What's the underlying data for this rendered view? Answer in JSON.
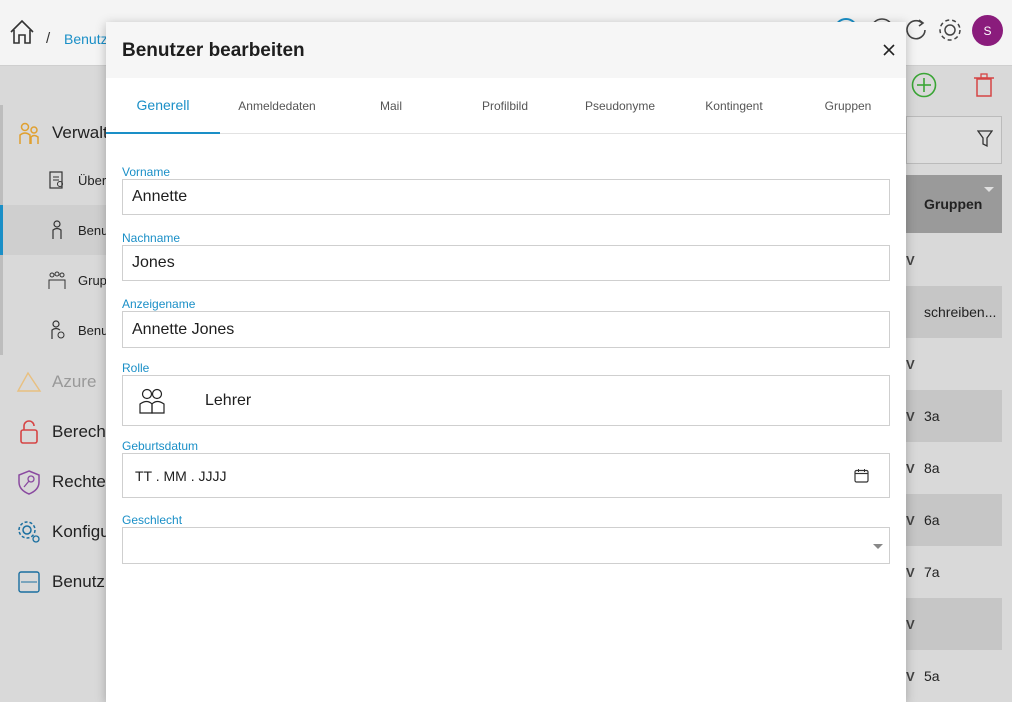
{
  "breadcrumb": {
    "separator": "/",
    "current": "Benutz"
  },
  "user": {
    "initial": "S"
  },
  "sidebar": {
    "items": [
      {
        "label": "Verwalt",
        "icon": "users-group-icon"
      },
      {
        "label": "Über",
        "icon": "overview-icon"
      },
      {
        "label": "Benu",
        "icon": "user-icon"
      },
      {
        "label": "Grup",
        "icon": "group-icon"
      },
      {
        "label": "Benu",
        "icon": "user-settings-icon"
      },
      {
        "label": "Azure",
        "icon": "azure-icon"
      },
      {
        "label": "Berecht",
        "icon": "lock-icon"
      },
      {
        "label": "Rechtev",
        "icon": "shield-key-icon"
      },
      {
        "label": "Konfigu",
        "icon": "gear-users-icon"
      },
      {
        "label": "Benutz",
        "icon": "log-icon"
      }
    ]
  },
  "table": {
    "header": "Gruppen",
    "rows": [
      {
        "check": "V",
        "text": ""
      },
      {
        "check": "",
        "text": "schreiben..."
      },
      {
        "check": "V",
        "text": ""
      },
      {
        "check": "V",
        "text": "3a"
      },
      {
        "check": "V",
        "text": "8a"
      },
      {
        "check": "V",
        "text": "6a"
      },
      {
        "check": "V",
        "text": "7a"
      },
      {
        "check": "V",
        "text": ""
      },
      {
        "check": "V",
        "text": "5a"
      }
    ]
  },
  "modal": {
    "title": "Benutzer bearbeiten",
    "tabs": [
      "Generell",
      "Anmeldedaten",
      "Mail",
      "Profilbild",
      "Pseudonyme",
      "Kontingent",
      "Gruppen"
    ],
    "fields": {
      "vorname": {
        "label": "Vorname",
        "value": "Annette"
      },
      "nachname": {
        "label": "Nachname",
        "value": "Jones"
      },
      "anzeigename": {
        "label": "Anzeigename",
        "value": "Annette Jones"
      },
      "rolle": {
        "label": "Rolle",
        "value": "Lehrer"
      },
      "geburtsdatum": {
        "label": "Geburtsdatum",
        "value": "TT . MM . JJJJ"
      },
      "geschlecht": {
        "label": "Geschlecht",
        "value": ""
      }
    }
  },
  "colors": {
    "accent": "#1a8fc7",
    "avatar": "#8a1c7c",
    "add": "#3aa535",
    "delete": "#d64545"
  }
}
